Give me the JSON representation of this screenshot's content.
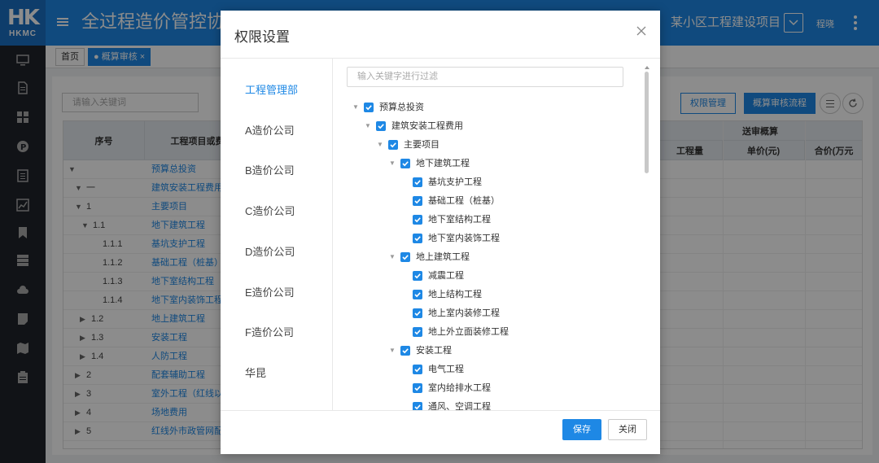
{
  "header": {
    "logo_mark": "HK",
    "logo_text": "HKMC",
    "title": "全过程造价管控协同",
    "project_name": "某小区工程建设项目",
    "user_name": "程晓",
    "color": "#1e88e5"
  },
  "tabs": [
    {
      "label": "首页"
    },
    {
      "label": "● 概算审核 ×"
    }
  ],
  "toolbar": {
    "search_placeholder": "请输入关键词",
    "perm_btn": "权限管理",
    "flow_btn": "概算审核流程"
  },
  "grid": {
    "headers": {
      "seq": "序号",
      "name": "工程项目或费",
      "group": "送审概算",
      "qty": "工程量",
      "unit_price": "单价(元)",
      "total": "合价(万元"
    },
    "rows": [
      {
        "arrow": "▼",
        "seq": "",
        "name": "预算总投资"
      },
      {
        "arrow": "▼",
        "seq": "一",
        "name": "建筑安装工程费用"
      },
      {
        "arrow": "▼",
        "seq": "1",
        "name": "主要项目"
      },
      {
        "arrow": "▼",
        "seq": "1.1",
        "name": "地下建筑工程"
      },
      {
        "arrow": "",
        "seq": "1.1.1",
        "name": "基坑支护工程"
      },
      {
        "arrow": "",
        "seq": "1.1.2",
        "name": "基础工程（桩基）"
      },
      {
        "arrow": "",
        "seq": "1.1.3",
        "name": "地下室结构工程"
      },
      {
        "arrow": "",
        "seq": "1.1.4",
        "name": "地下室内装饰工程"
      },
      {
        "arrow": "▶",
        "seq": "1.2",
        "name": "地上建筑工程"
      },
      {
        "arrow": "▶",
        "seq": "1.3",
        "name": "安装工程"
      },
      {
        "arrow": "▶",
        "seq": "1.4",
        "name": "人防工程"
      },
      {
        "arrow": "▶",
        "seq": "2",
        "name": "配套辅助工程"
      },
      {
        "arrow": "▶",
        "seq": "3",
        "name": "室外工程（红线以内"
      },
      {
        "arrow": "▶",
        "seq": "4",
        "name": "场地费用"
      },
      {
        "arrow": "▶",
        "seq": "5",
        "name": "红线外市政管网配"
      }
    ]
  },
  "dialog": {
    "title": "权限设置",
    "departments": [
      "工程管理部",
      "A造价公司",
      "B造价公司",
      "C造价公司",
      "D造价公司",
      "E造价公司",
      "F造价公司",
      "华昆"
    ],
    "active_department": "工程管理部",
    "filter_placeholder": "输入关键字进行过滤",
    "tree": [
      {
        "label": "预算总投资",
        "level": 0,
        "expanded": true,
        "checked": true
      },
      {
        "label": "建筑安装工程费用",
        "level": 1,
        "expanded": true,
        "checked": true
      },
      {
        "label": "主要项目",
        "level": 2,
        "expanded": true,
        "checked": true
      },
      {
        "label": "地下建筑工程",
        "level": 3,
        "expanded": true,
        "checked": true
      },
      {
        "label": "基坑支护工程",
        "level": 4,
        "expanded": null,
        "checked": true
      },
      {
        "label": "基础工程（桩基）",
        "level": 4,
        "expanded": null,
        "checked": true
      },
      {
        "label": "地下室结构工程",
        "level": 4,
        "expanded": null,
        "checked": true
      },
      {
        "label": "地下室内装饰工程",
        "level": 4,
        "expanded": null,
        "checked": true
      },
      {
        "label": "地上建筑工程",
        "level": 3,
        "expanded": true,
        "checked": true
      },
      {
        "label": "减震工程",
        "level": 4,
        "expanded": null,
        "checked": true
      },
      {
        "label": "地上结构工程",
        "level": 4,
        "expanded": null,
        "checked": true
      },
      {
        "label": "地上室内装修工程",
        "level": 4,
        "expanded": null,
        "checked": true
      },
      {
        "label": "地上外立面装修工程",
        "level": 4,
        "expanded": null,
        "checked": true
      },
      {
        "label": "安装工程",
        "level": 3,
        "expanded": true,
        "checked": true
      },
      {
        "label": "电气工程",
        "level": 4,
        "expanded": null,
        "checked": true
      },
      {
        "label": "室内给排水工程",
        "level": 4,
        "expanded": null,
        "checked": true
      },
      {
        "label": "通风、空调工程",
        "level": 4,
        "expanded": null,
        "checked": true
      }
    ],
    "save_label": "保存",
    "close_label": "关闭"
  }
}
